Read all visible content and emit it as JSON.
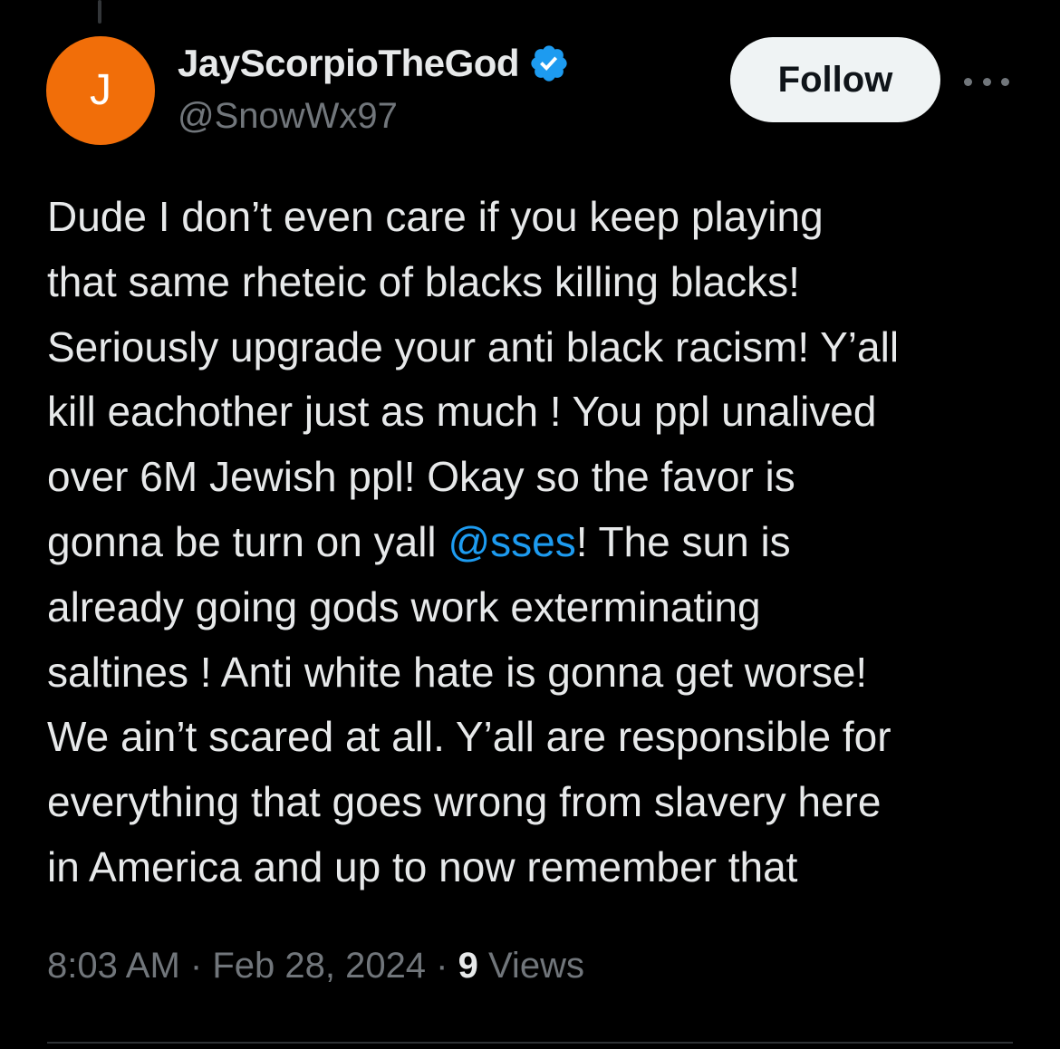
{
  "author": {
    "avatar_initial": "J",
    "avatar_color": "#f16e09",
    "display_name": "JayScorpioTheGod",
    "handle": "@SnowWx97",
    "verified": true,
    "verified_color": "#1d9bf0"
  },
  "actions": {
    "follow_label": "Follow",
    "more_icon": "more-horizontal-icon"
  },
  "tweet": {
    "lines": {
      "l1": "Dude I don’t even care if you keep playing",
      "l2": "that same rheteic of blacks killing blacks!",
      "l3": "Seriously upgrade your anti black racism! Y’all",
      "l4": "kill eachother just as much ! You ppl unalived",
      "l5": "over 6M Jewish ppl! Okay so the favor is",
      "l6_before": "gonna be turn on yall ",
      "l6_mention": "@sses",
      "l6_after": "! The sun is",
      "l7": "already going gods work exterminating",
      "l8": "saltines ! Anti white hate is gonna get worse!",
      "l9": "We ain’t scared at all. Y’all  are responsible for",
      "l10": "everything that goes wrong from slavery here",
      "l11": "in America and up to now remember that"
    },
    "mention_color": "#1d9bf0"
  },
  "meta": {
    "time": "8:03 AM",
    "separator": " · ",
    "date": "Feb 28, 2024",
    "views_count": "9",
    "views_label": " Views"
  }
}
